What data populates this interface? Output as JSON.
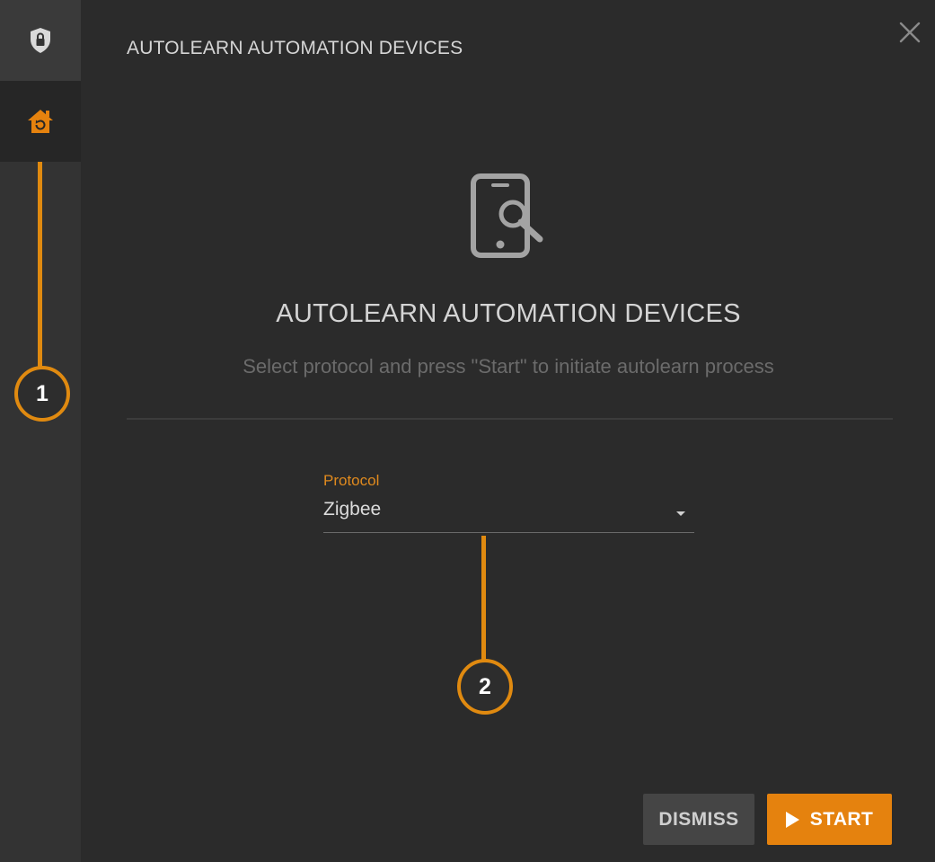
{
  "dialog": {
    "header_title": "AUTOLEARN AUTOMATION DEVICES",
    "hero_title": "AUTOLEARN AUTOMATION DEVICES",
    "hero_subtitle": "Select protocol and press \"Start\" to initiate autolearn process"
  },
  "sidebar": {
    "items": [
      {
        "icon": "shield-lock-icon",
        "active": false
      },
      {
        "icon": "home-refresh-icon",
        "active": true
      }
    ]
  },
  "protocol_field": {
    "label": "Protocol",
    "value": "Zigbee"
  },
  "buttons": {
    "dismiss_label": "DISMISS",
    "start_label": "START"
  },
  "callouts": [
    "1",
    "2"
  ],
  "colors": {
    "accent": "#e5820e",
    "background": "#2b2b2b",
    "sidebar": "#333333"
  }
}
